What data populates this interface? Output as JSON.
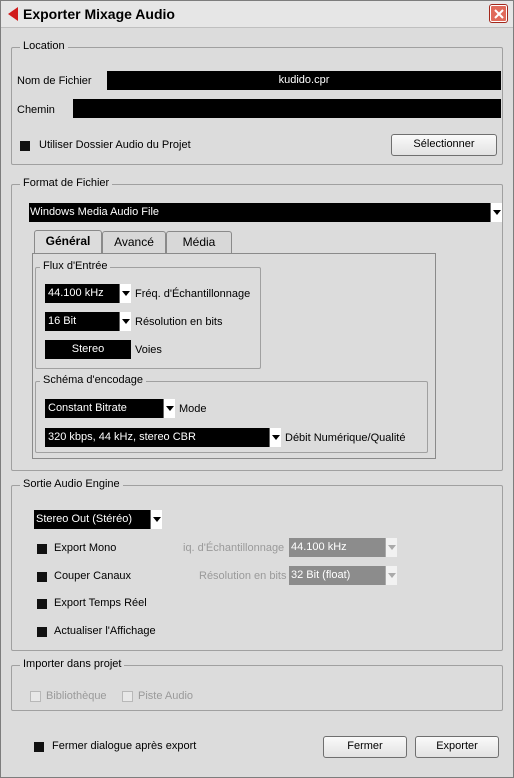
{
  "window": {
    "title": "Exporter Mixage Audio"
  },
  "location": {
    "legend": "Location",
    "filename_label": "Nom de Fichier",
    "filename_value": "kudido.cpr",
    "path_label": "Chemin",
    "path_value": "",
    "use_project_folder_label": "Utiliser Dossier Audio du Projet",
    "select_button": "Sélectionner"
  },
  "format": {
    "legend": "Format de Fichier",
    "file_type": "Windows Media Audio File",
    "tabs": [
      "Général",
      "Avancé",
      "Média"
    ],
    "input_stream": {
      "legend": "Flux d'Entrée",
      "sample_rate": "44.100 kHz",
      "sample_rate_label": "Fréq. d'Échantillonnage",
      "bit_depth": "16 Bit",
      "bit_depth_label": "Résolution en bits",
      "channels": "Stereo",
      "channels_label": "Voies"
    },
    "encoding": {
      "legend": "Schéma d'encodage",
      "mode": "Constant Bitrate",
      "mode_label": "Mode",
      "bitrate": "320 kbps, 44 kHz, stereo CBR",
      "bitrate_label": "Débit  Numérique/Qualité"
    }
  },
  "engine": {
    "legend": "Sortie Audio Engine",
    "output": "Stereo Out (Stéréo)",
    "export_mono": "Export Mono",
    "split_channels": "Couper Canaux",
    "realtime": "Export Temps Réel",
    "refresh_display": "Actualiser l'Affichage",
    "sample_rate_label": "iq. d'Échantillonnage",
    "sample_rate_value": "44.100 kHz",
    "bit_depth_label": "Résolution en bits",
    "bit_depth_value": "32 Bit (float)"
  },
  "import": {
    "legend": "Importer dans projet",
    "pool": "Bibliothèque",
    "audio_track": "Piste Audio"
  },
  "footer": {
    "close_after_export": "Fermer dialogue après export",
    "close_button": "Fermer",
    "export_button": "Exporter"
  },
  "colors": {
    "title_icon": "#d11c1c",
    "close_button": "#e06a5a",
    "field_bg": "#000000",
    "dialog_bg": "#dcdcdc"
  }
}
